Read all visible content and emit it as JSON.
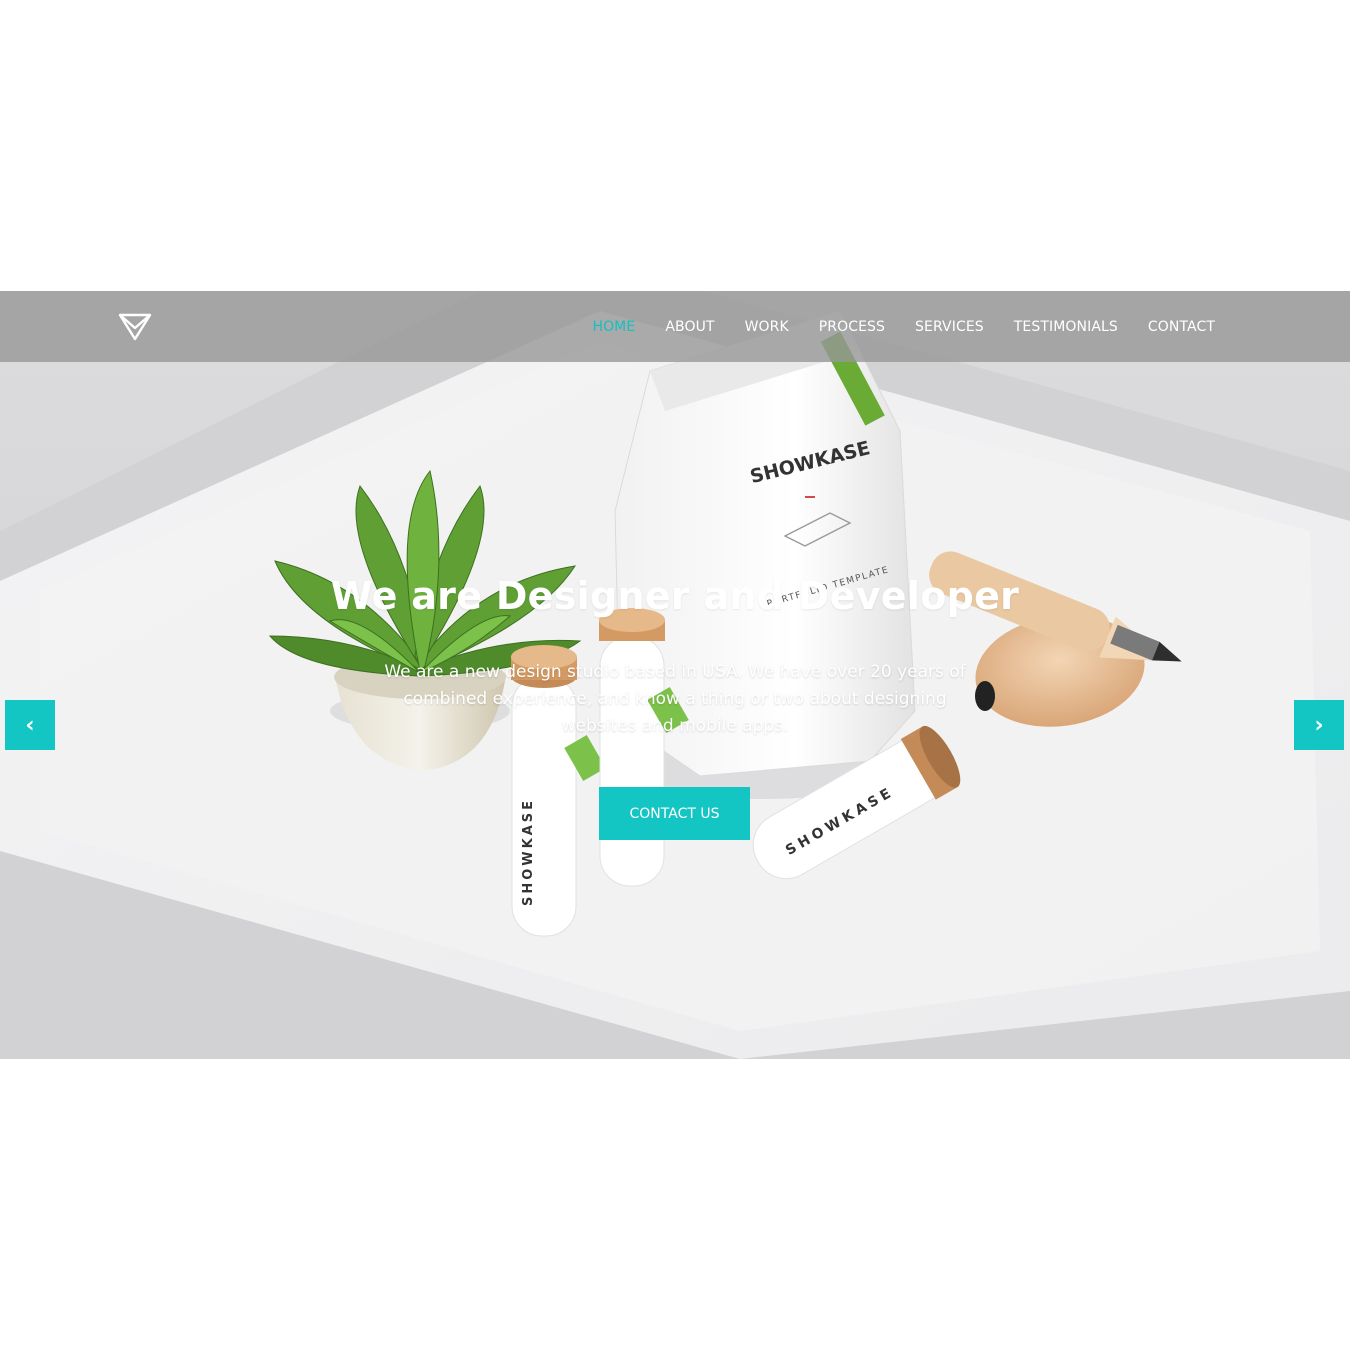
{
  "brand": {
    "logo_icon": "triangle-logo-icon"
  },
  "nav": {
    "items": [
      {
        "label": "HOME",
        "active": true
      },
      {
        "label": "ABOUT",
        "active": false
      },
      {
        "label": "WORK",
        "active": false
      },
      {
        "label": "PROCESS",
        "active": false
      },
      {
        "label": "SERVICES",
        "active": false
      },
      {
        "label": "TESTIMONIALS",
        "active": false
      },
      {
        "label": "CONTACT",
        "active": false
      }
    ]
  },
  "hero": {
    "title": "We are Designer and Developer",
    "subtitle": "We are a new design studio based in USA. We have over 20 years of combined experience, and know a thing or two about designing websites and mobile apps.",
    "cta_label": "CONTACT US",
    "prev_arrow": "‹",
    "next_arrow": "›",
    "bag_label": "SHOWKASE",
    "bag_sub": "PORTFOLIO TEMPLATE",
    "tube_label": "SHOWKASE"
  },
  "colors": {
    "accent": "#13c5c3",
    "nav_bg": "#969696",
    "text_light": "#ffffff"
  }
}
